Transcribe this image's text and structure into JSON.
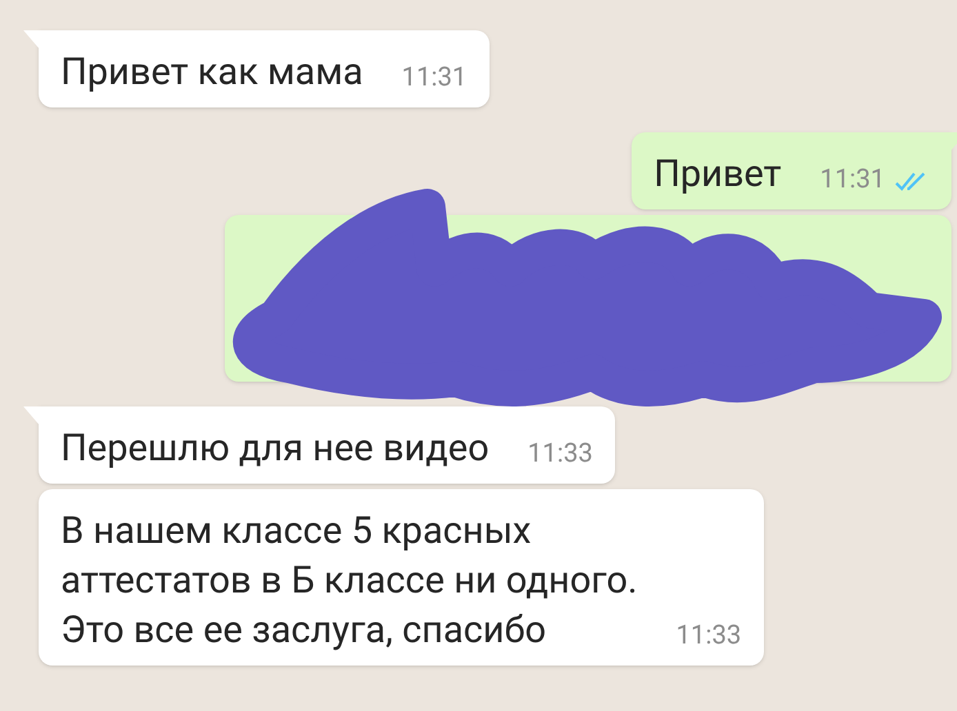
{
  "messages": [
    {
      "kind": "text",
      "outgoing": false,
      "text": "Привет как мама",
      "time": "11:31",
      "tail": true
    },
    {
      "kind": "text",
      "outgoing": true,
      "text": "Привет",
      "time": "11:31",
      "read": true,
      "tail": true
    },
    {
      "kind": "hidden",
      "outgoing": true,
      "tail": false
    },
    {
      "kind": "text",
      "outgoing": false,
      "text": "Перешлю для нее видео",
      "time": "11:33",
      "tail": true
    },
    {
      "kind": "text",
      "outgoing": false,
      "text": "В нашем классе 5 красных\nаттестатов в Б классе ни одного.\nЭто все ее заслуга, спасибо",
      "time": "11:33",
      "tail": false
    }
  ]
}
